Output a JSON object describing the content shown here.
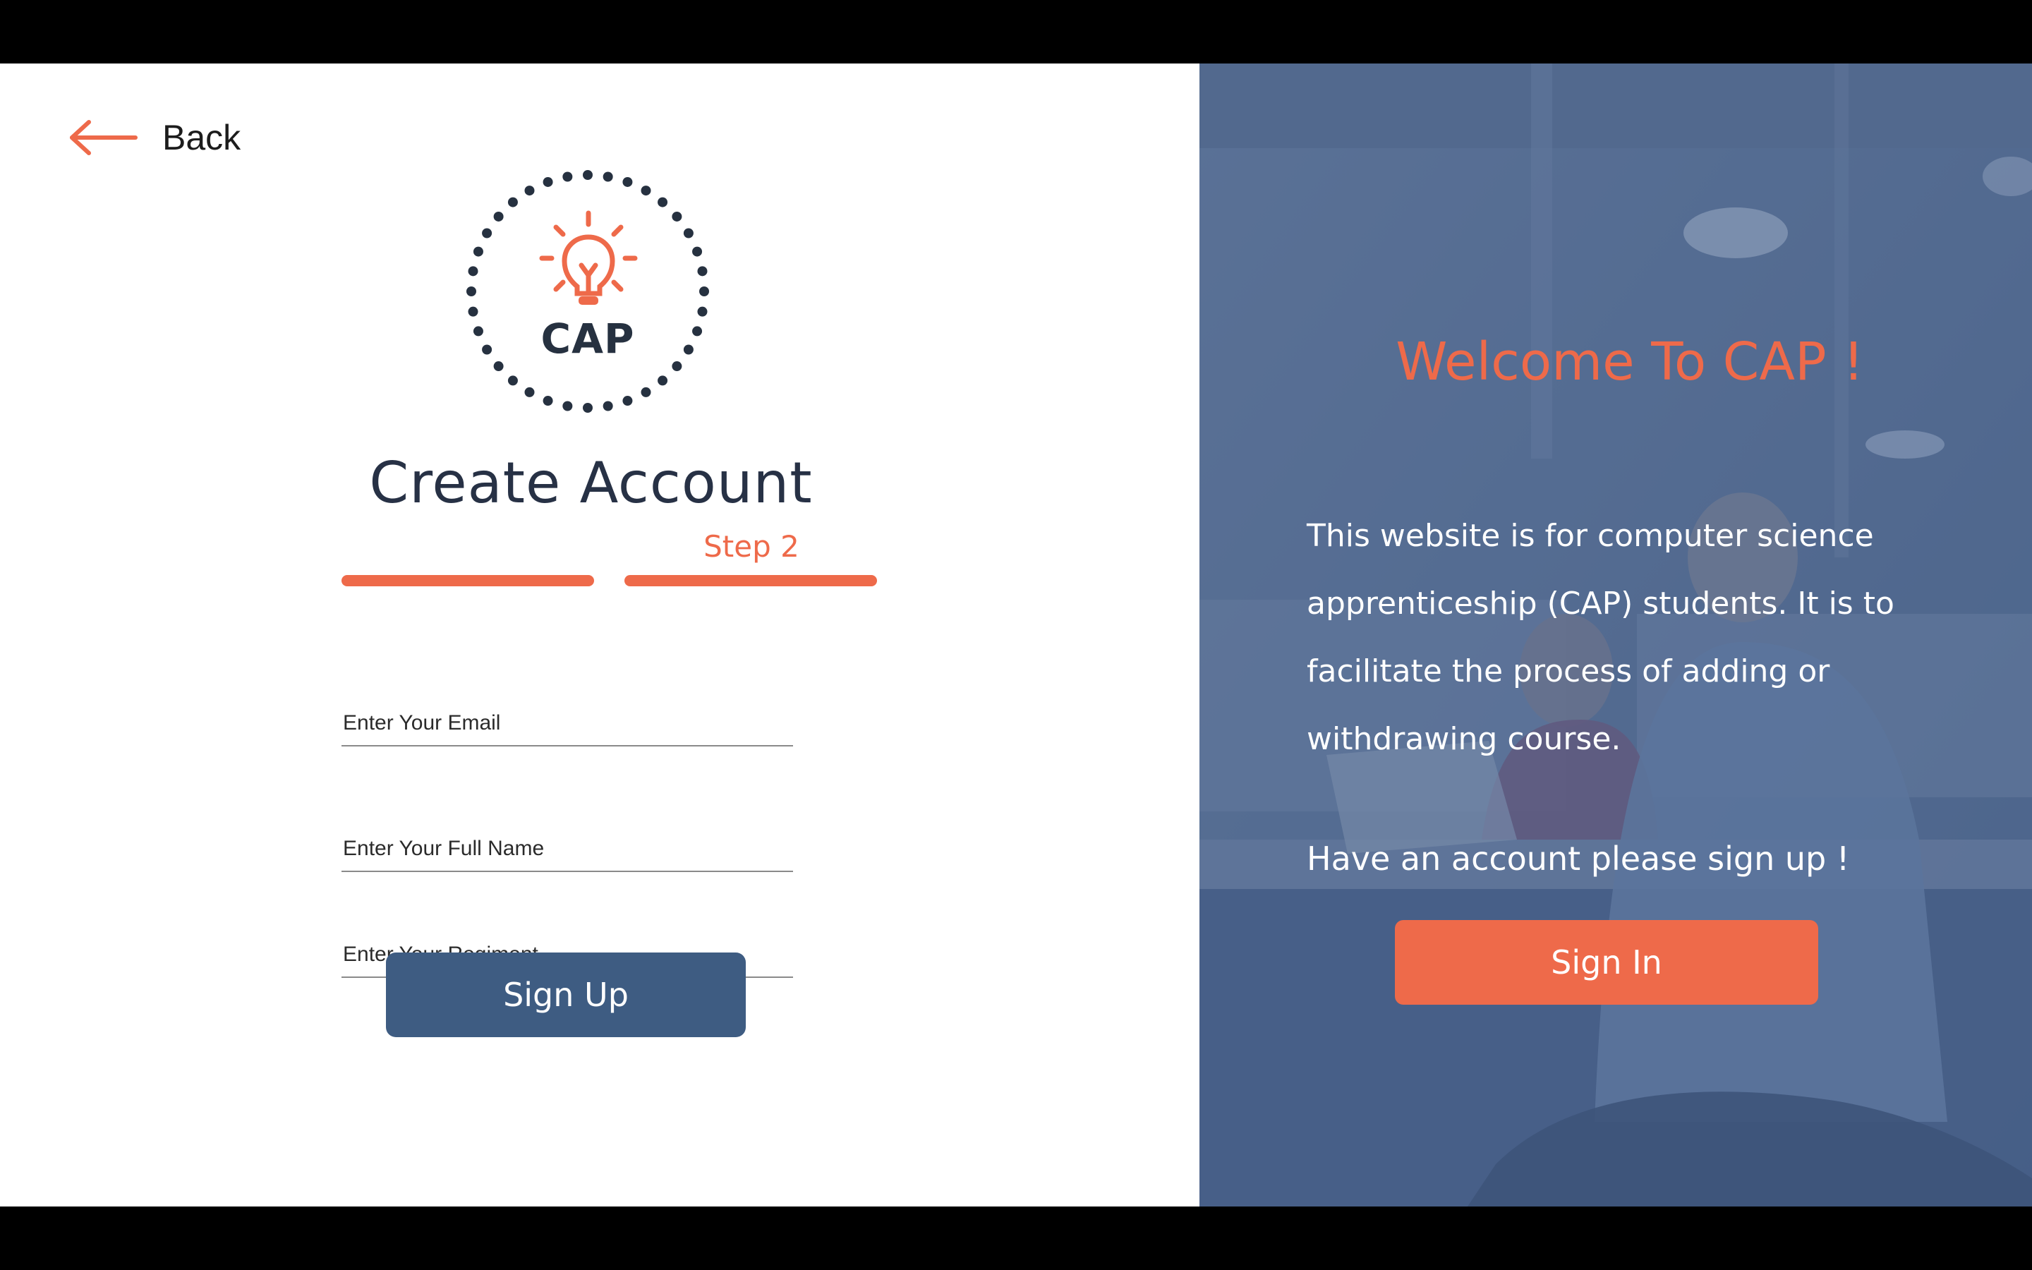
{
  "nav": {
    "back_label": "Back"
  },
  "logo": {
    "text": "CAP"
  },
  "form": {
    "title": "Create Account",
    "step_label": "Step 2",
    "email_placeholder": "Enter Your Email",
    "fullname_placeholder": "Enter Your Full Name",
    "regiment_placeholder": "Enter Your Regiment",
    "submit_label": "Sign Up"
  },
  "side": {
    "welcome": "Welcome To CAP !",
    "description": "This website is for computer science apprenticeship (CAP) students. It is to facilitate the process of adding or withdrawing course.",
    "account_note": "Have an account please sign up !",
    "signin_label": "Sign In"
  },
  "colors": {
    "accent": "#ee6a4a",
    "primary_button": "#3e5c82",
    "heading": "#273145"
  },
  "icons": [
    "back-arrow-icon",
    "lightbulb-icon"
  ]
}
